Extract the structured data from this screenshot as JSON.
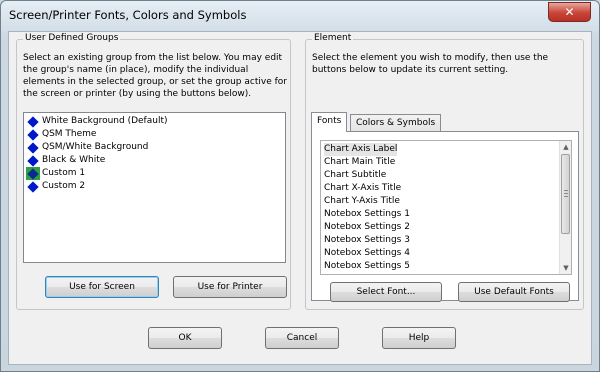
{
  "window": {
    "title": "Screen/Printer Fonts, Colors and Symbols",
    "close_glyph": "✕"
  },
  "groups_panel": {
    "title": "User Defined Groups",
    "description": "Select an existing group from the list below.  You may edit the group's name (in place), modify the individual elements in the selected group, or set the group active for the screen or printer (by using the buttons below).",
    "items": [
      {
        "label": "White Background (Default)",
        "icon": "blue-diamond-icon",
        "active": false
      },
      {
        "label": "QSM Theme",
        "icon": "blue-diamond-icon",
        "active": false
      },
      {
        "label": "QSM/White Background",
        "icon": "blue-diamond-icon",
        "active": false
      },
      {
        "label": "Black & White",
        "icon": "blue-diamond-icon",
        "active": false
      },
      {
        "label": "Custom 1",
        "icon": "screen-printer-active-icon",
        "active": true
      },
      {
        "label": "Custom 2",
        "icon": "blue-diamond-icon",
        "active": false
      }
    ],
    "use_for_screen_label": "Use for Screen",
    "use_for_printer_label": "Use for Printer"
  },
  "element_panel": {
    "title": "Element",
    "description": "Select the element you wish to modify, then use the buttons below to update its current setting.",
    "tabs": [
      {
        "label": "Fonts",
        "active": true
      },
      {
        "label": "Colors & Symbols",
        "active": false
      }
    ],
    "items": [
      {
        "label": "Chart Axis Label",
        "selected": true
      },
      {
        "label": "Chart Main Title",
        "selected": false
      },
      {
        "label": "Chart Subtitle",
        "selected": false
      },
      {
        "label": "Chart X-Axis Title",
        "selected": false
      },
      {
        "label": "Chart Y-Axis Title",
        "selected": false
      },
      {
        "label": "Notebox Settings 1",
        "selected": false
      },
      {
        "label": "Notebox Settings 2",
        "selected": false
      },
      {
        "label": "Notebox Settings 3",
        "selected": false
      },
      {
        "label": "Notebox Settings 4",
        "selected": false
      },
      {
        "label": "Notebox Settings 5",
        "selected": false
      }
    ],
    "select_font_label": "Select Font...",
    "use_default_fonts_label": "Use Default Fonts"
  },
  "footer": {
    "ok_label": "OK",
    "cancel_label": "Cancel",
    "help_label": "Help"
  },
  "colors": {
    "diamond": "#0018c8",
    "active_icon_bg": "#2ea043",
    "close_button": "#c7453a"
  }
}
